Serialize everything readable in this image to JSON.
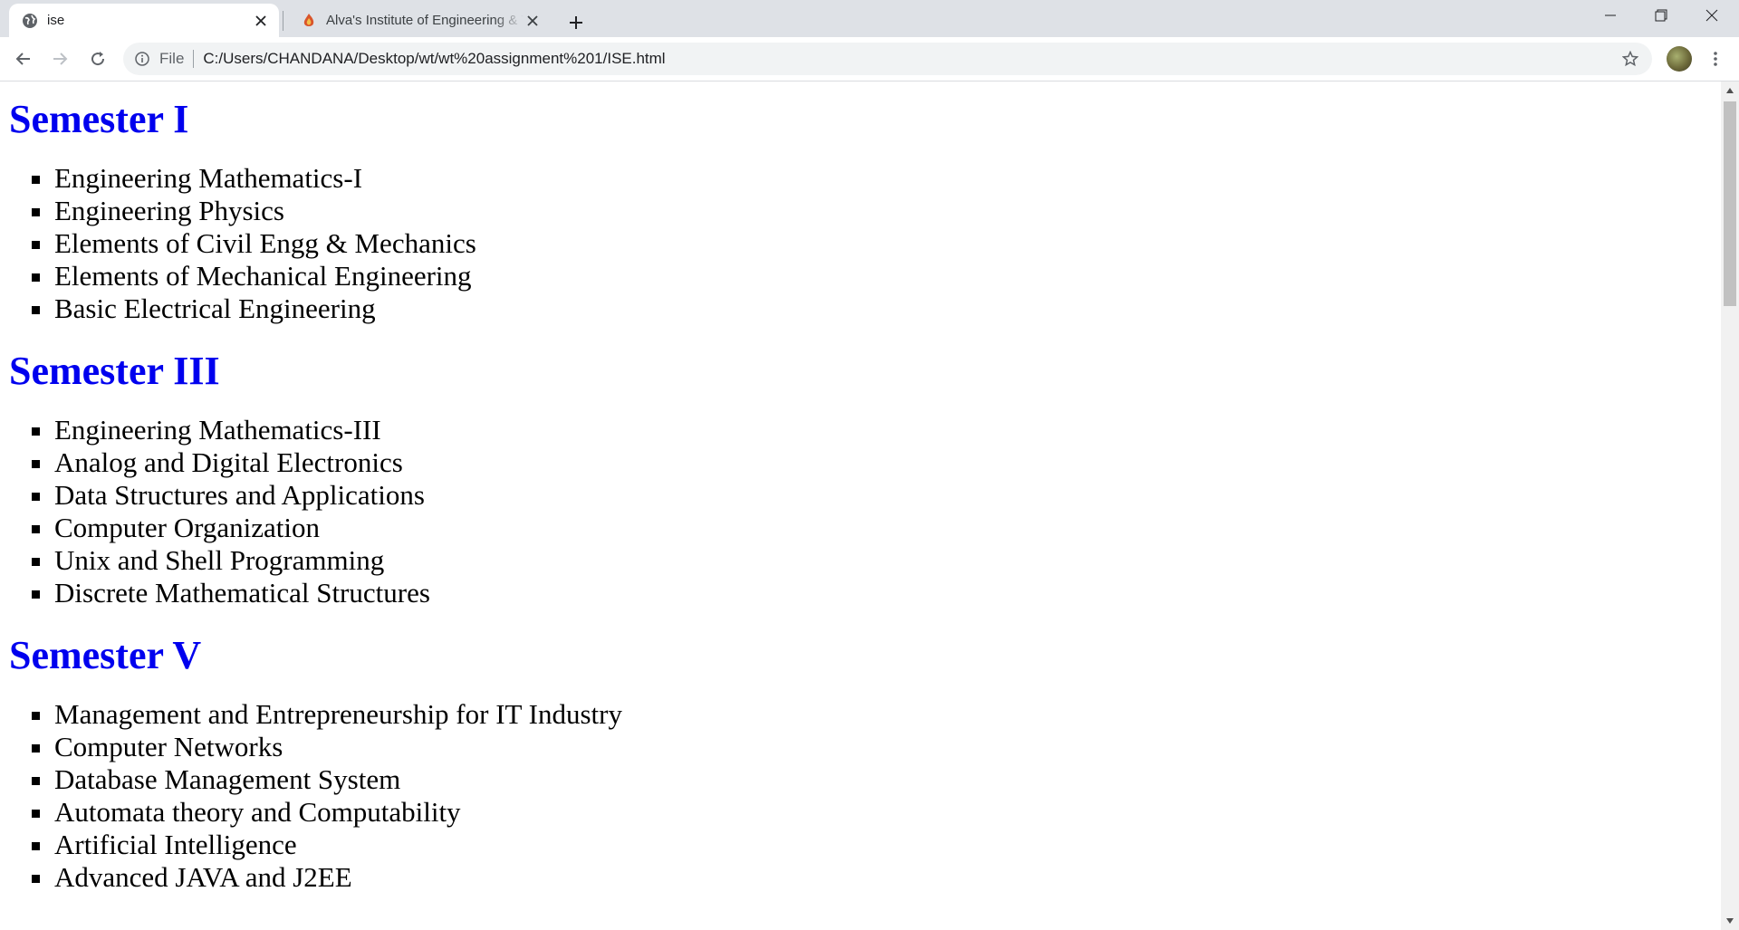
{
  "browser": {
    "tabs": [
      {
        "title": "ise",
        "icon": "globe-icon",
        "active": true
      },
      {
        "title": "Alva's Institute of Engineering & Technology",
        "icon": "alvas-logo-icon",
        "active": false
      }
    ],
    "address": {
      "scheme_label": "File",
      "url": "C:/Users/CHANDANA/Desktop/wt/wt%20assignment%201/ISE.html"
    },
    "colors": {
      "tabstrip": "#dee1e6",
      "omnibox": "#f1f3f4"
    }
  },
  "page": {
    "heading_color": "#0000ee",
    "semesters": [
      {
        "title": "Semester I",
        "subjects": [
          "Engineering Mathematics-I",
          "Engineering Physics",
          "Elements of Civil Engg & Mechanics",
          "Elements of Mechanical Engineering",
          "Basic Electrical Engineering"
        ]
      },
      {
        "title": "Semester III",
        "subjects": [
          "Engineering Mathematics-III",
          "Analog and Digital Electronics",
          "Data Structures and Applications",
          "Computer Organization",
          "Unix and Shell Programming",
          "Discrete Mathematical Structures"
        ]
      },
      {
        "title": "Semester V",
        "subjects": [
          "Management and Entrepreneurship for IT Industry",
          "Computer Networks",
          "Database Management System",
          "Automata theory and Computability",
          "Artificial Intelligence",
          "Advanced JAVA and J2EE"
        ]
      }
    ]
  }
}
